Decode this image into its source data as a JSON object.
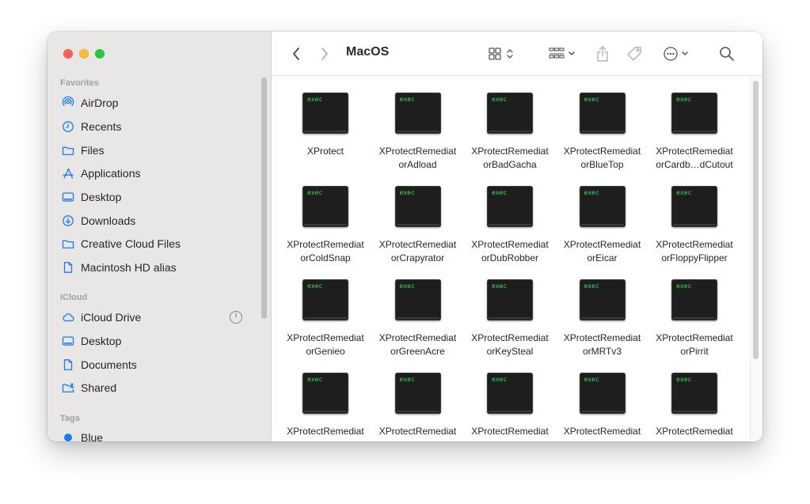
{
  "window": {
    "title": "MacOS"
  },
  "sidebar": {
    "sections": [
      {
        "label": "Favorites",
        "items": [
          {
            "label": "AirDrop",
            "icon": "airdrop-icon"
          },
          {
            "label": "Recents",
            "icon": "clock-icon"
          },
          {
            "label": "Files",
            "icon": "folder-icon"
          },
          {
            "label": "Applications",
            "icon": "applications-icon"
          },
          {
            "label": "Desktop",
            "icon": "desktop-icon"
          },
          {
            "label": "Downloads",
            "icon": "download-icon"
          },
          {
            "label": "Creative Cloud Files",
            "icon": "folder-icon"
          },
          {
            "label": "Macintosh HD alias",
            "icon": "document-icon"
          }
        ]
      },
      {
        "label": "iCloud",
        "items": [
          {
            "label": "iCloud Drive",
            "icon": "cloud-icon"
          },
          {
            "label": "Desktop",
            "icon": "desktop-icon"
          },
          {
            "label": "Documents",
            "icon": "document-icon"
          },
          {
            "label": "Shared",
            "icon": "shared-folder-icon"
          }
        ]
      },
      {
        "label": "Tags",
        "items": [
          {
            "label": "Blue",
            "icon": "tag-dot-icon",
            "color": "#1a7cf5"
          }
        ]
      }
    ]
  },
  "files": [
    {
      "name": "XProtect",
      "icon_text": "exec"
    },
    {
      "name": "XProtectRemediat\norAdload",
      "icon_text": "exec"
    },
    {
      "name": "XProtectRemediat\norBadGacha",
      "icon_text": "exec"
    },
    {
      "name": "XProtectRemediat\norBlueTop",
      "icon_text": "exec"
    },
    {
      "name": "XProtectRemediat\norCardb…dCutout",
      "icon_text": "exec"
    },
    {
      "name": "XProtectRemediat\norColdSnap",
      "icon_text": "exec"
    },
    {
      "name": "XProtectRemediat\norCrapyrator",
      "icon_text": "exec"
    },
    {
      "name": "XProtectRemediat\norDubRobber",
      "icon_text": "exec"
    },
    {
      "name": "XProtectRemediat\norEicar",
      "icon_text": "exec"
    },
    {
      "name": "XProtectRemediat\norFloppyFlipper",
      "icon_text": "exec"
    },
    {
      "name": "XProtectRemediat\norGenieo",
      "icon_text": "exec"
    },
    {
      "name": "XProtectRemediat\norGreenAcre",
      "icon_text": "exec"
    },
    {
      "name": "XProtectRemediat\norKeySteal",
      "icon_text": "exec"
    },
    {
      "name": "XProtectRemediat\norMRTv3",
      "icon_text": "exec"
    },
    {
      "name": "XProtectRemediat\norPirrit",
      "icon_text": "exec"
    },
    {
      "name": "XProtectRemediat",
      "icon_text": "exec"
    },
    {
      "name": "XProtectRemediat",
      "icon_text": "exec"
    },
    {
      "name": "XProtectRemediat",
      "icon_text": "exec"
    },
    {
      "name": "XProtectRemediat",
      "icon_text": "exec"
    },
    {
      "name": "XProtectRemediat",
      "icon_text": "exec"
    }
  ],
  "colors": {
    "exec_text": "#3ddc5a",
    "tag_blue": "#1a7cf5",
    "traffic_close": "#fe5f57",
    "traffic_min": "#febc2e",
    "traffic_max": "#28c840"
  }
}
